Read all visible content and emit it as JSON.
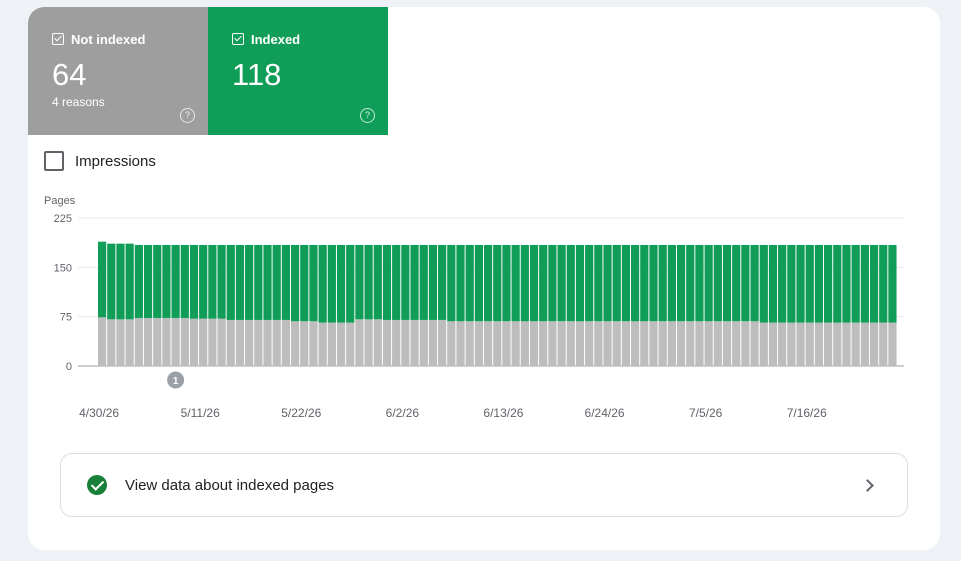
{
  "tiles": {
    "not_indexed": {
      "label": "Not indexed",
      "count": "64",
      "sub": "4 reasons",
      "help": "?",
      "color": "#9e9e9e"
    },
    "indexed": {
      "label": "Indexed",
      "count": "118",
      "help": "?",
      "color": "#0f9d58"
    }
  },
  "impressions_label": "Impressions",
  "view_data_label": "View data about indexed pages",
  "chart_data": {
    "type": "bar",
    "stacked": true,
    "ylabel": "Pages",
    "ylim": [
      0,
      225
    ],
    "y_ticks": [
      "225",
      "150",
      "75",
      "0"
    ],
    "x_tick_labels": [
      "4/30/26",
      "5/11/26",
      "5/22/26",
      "6/2/26",
      "6/13/26",
      "6/24/26",
      "7/5/26",
      "7/16/26"
    ],
    "grid": true,
    "annotation": {
      "label": "1",
      "date": "5/8/26"
    },
    "series": [
      {
        "color": "#bdbdbd",
        "values": [
          74,
          71,
          71,
          71,
          73,
          73,
          73,
          73,
          73,
          73,
          72,
          72,
          72,
          72,
          70,
          70,
          70,
          70,
          70,
          70,
          70,
          68,
          68,
          68,
          66,
          66,
          66,
          66,
          71,
          71,
          71,
          70,
          70,
          70,
          70,
          70,
          70,
          70,
          68,
          68,
          68,
          68,
          68,
          68,
          68,
          68,
          68,
          68,
          68,
          68,
          68,
          68,
          68,
          68,
          68,
          68,
          68,
          68,
          68,
          68,
          68,
          68,
          68,
          68,
          68,
          68,
          68,
          68,
          68,
          68,
          68,
          68,
          66,
          66,
          66,
          66,
          66,
          66,
          66,
          66,
          66,
          66,
          66,
          66,
          66,
          66,
          66
        ]
      },
      {
        "color": "#0f9d58",
        "values": [
          115,
          115,
          115,
          115,
          111,
          111,
          111,
          111,
          111,
          111,
          112,
          112,
          112,
          112,
          114,
          114,
          114,
          114,
          114,
          114,
          114,
          116,
          116,
          116,
          118,
          118,
          118,
          118,
          113,
          113,
          113,
          114,
          114,
          114,
          114,
          114,
          114,
          114,
          116,
          116,
          116,
          116,
          116,
          116,
          116,
          116,
          116,
          116,
          116,
          116,
          116,
          116,
          116,
          116,
          116,
          116,
          116,
          116,
          116,
          116,
          116,
          116,
          116,
          116,
          116,
          116,
          116,
          116,
          116,
          116,
          116,
          116,
          118,
          118,
          118,
          118,
          118,
          118,
          118,
          118,
          118,
          118,
          118,
          118,
          118,
          118,
          118
        ]
      }
    ]
  }
}
